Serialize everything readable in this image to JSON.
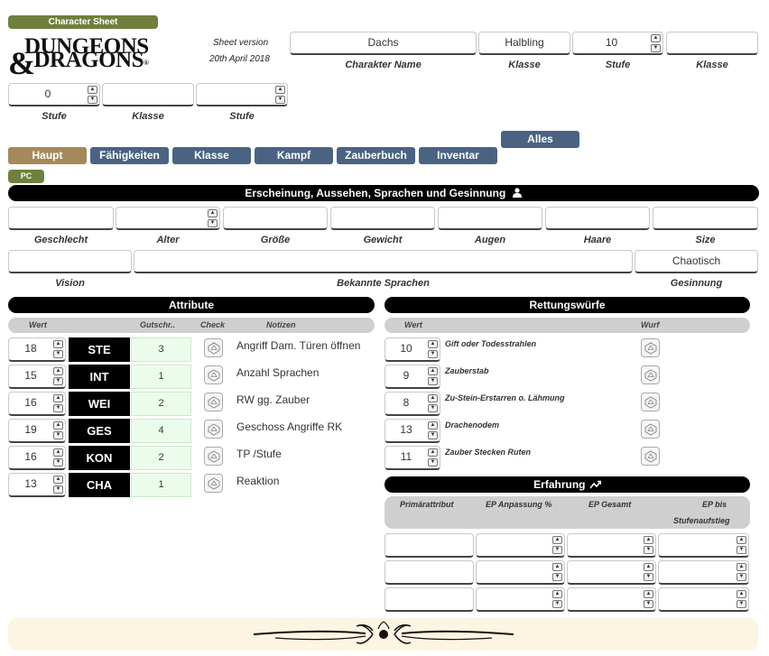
{
  "header": {
    "badge": "Character Sheet",
    "logo_line1": "DUNGEONS",
    "logo_amp": "&",
    "logo_line2": "DRAGONS",
    "logo_reg": "®",
    "version_label": "Sheet version",
    "version_date": "20th April 2018"
  },
  "top_fields": {
    "name": {
      "value": "Dachs",
      "label": "Charakter Name"
    },
    "class1": {
      "value": "Halbling",
      "label": "Klasse"
    },
    "level1": {
      "value": "10",
      "label": "Stufe"
    },
    "class2": {
      "value": "",
      "label": "Klasse"
    },
    "level2": {
      "value": "0",
      "label": "Stufe"
    },
    "class3": {
      "value": "",
      "label": "Klasse"
    },
    "level3": {
      "value": "",
      "label": "Stufe"
    }
  },
  "tabs": {
    "haupt": "Haupt",
    "faehigkeiten": "Fähigkeiten",
    "klasse": "Klasse",
    "kampf": "Kampf",
    "zauberbuch": "Zauberbuch",
    "inventar": "Inventar",
    "alles": "Alles",
    "pc": "PC"
  },
  "appearance": {
    "title": "Erscheinung, Aussehen, Sprachen und Gesinnung",
    "labels": [
      "Geschlecht",
      "Alter",
      "Größe",
      "Gewicht",
      "Augen",
      "Haare",
      "Size"
    ],
    "values": [
      "",
      "",
      "",
      "",
      "",
      "",
      ""
    ],
    "vision_label": "Vision",
    "vision_value": "",
    "languages_label": "Bekannte Sprachen",
    "languages_value": "",
    "alignment_label": "Gesinnung",
    "alignment_value": "Chaotisch"
  },
  "attributes": {
    "title": "Attribute",
    "col_wert": "Wert",
    "col_gutschr": "Gutschr..",
    "col_check": "Check",
    "col_notizen": "Notizen",
    "rows": [
      {
        "value": "18",
        "name": "STE",
        "mod": "3",
        "note": "Angriff Dam. Türen öffnen"
      },
      {
        "value": "15",
        "name": "INT",
        "mod": "1",
        "note": "Anzahl Sprachen"
      },
      {
        "value": "16",
        "name": "WEI",
        "mod": "2",
        "note": "RW gg. Zauber"
      },
      {
        "value": "19",
        "name": "GES",
        "mod": "4",
        "note": "Geschoss Angriffe RK"
      },
      {
        "value": "16",
        "name": "KON",
        "mod": "2",
        "note": "TP /Stufe"
      },
      {
        "value": "13",
        "name": "CHA",
        "mod": "1",
        "note": "Reaktion"
      }
    ]
  },
  "saves": {
    "title": "Rettungswürfe",
    "col_wert": "Wert",
    "col_wurf": "Wurf",
    "rows": [
      {
        "value": "10",
        "name": "Gift oder Todesstrahlen"
      },
      {
        "value": "9",
        "name": "Zauberstab"
      },
      {
        "value": "8",
        "name": "Zu-Stein-Erstarren o. Lähmung"
      },
      {
        "value": "13",
        "name": "Drachenodem"
      },
      {
        "value": "11",
        "name": "Zauber Stecken Ruten"
      }
    ]
  },
  "experience": {
    "title": "Erfahrung",
    "col1": "Primärattribut",
    "col2": "EP Anpassung %",
    "col3": "EP Gesamt",
    "col4_line1": "EP bis",
    "col4_line2": "Stufenaufstieg"
  }
}
